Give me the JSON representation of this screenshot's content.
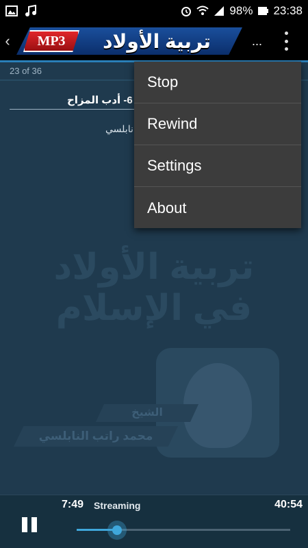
{
  "status_bar": {
    "battery": "98%",
    "time": "23:38",
    "icons": [
      "image-icon",
      "music-note-icon",
      "alarm-icon",
      "wifi-icon",
      "signal-icon",
      "battery-icon"
    ]
  },
  "toolbar": {
    "badge": "MP3",
    "title": "تربية الأولاد",
    "ellipsis": "..."
  },
  "track": {
    "count": "23 of 36",
    "title": "6- أدب المزاح",
    "artist": "نابلسي"
  },
  "background_art": {
    "line1": "تربية الأولاد",
    "line2": "في الإسلام",
    "label1": "الشيخ",
    "label2": "محمد راتب النابلسي"
  },
  "menu": {
    "items": [
      {
        "label": "Stop"
      },
      {
        "label": "Rewind"
      },
      {
        "label": "Settings"
      },
      {
        "label": "About"
      }
    ]
  },
  "player": {
    "current_time": "7:49",
    "status": "Streaming",
    "total_time": "40:54",
    "progress": 0.19
  },
  "colors": {
    "accent": "#3fa7db",
    "menu_bg": "#3c3c3c",
    "screen_bg": "#1f3a4e"
  }
}
